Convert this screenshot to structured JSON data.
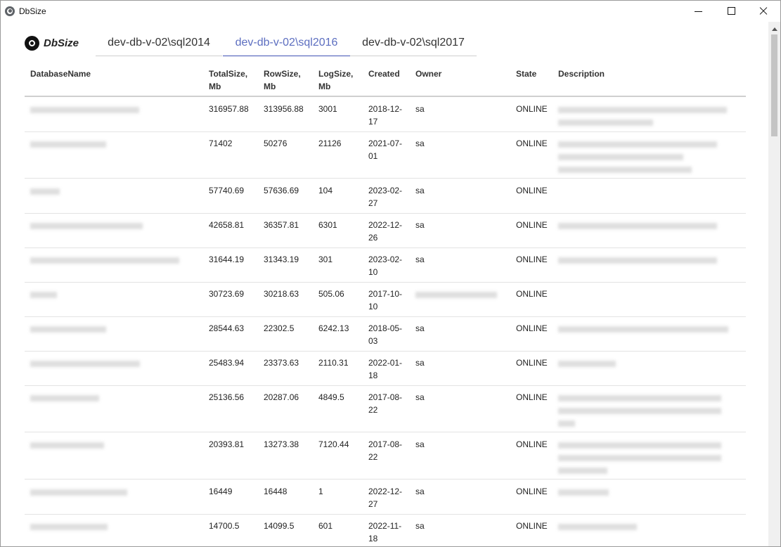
{
  "window": {
    "title": "DbSize",
    "minimize_label": "—",
    "maximize_label": "□",
    "close_label": "✕"
  },
  "brand": {
    "label": "DbSize",
    "icon": "github-icon"
  },
  "tabs": [
    {
      "label": "dev-db-v-02\\sql2014",
      "active": false
    },
    {
      "label": "dev-db-v-02\\sql2016",
      "active": true
    },
    {
      "label": "dev-db-v-02\\sql2017",
      "active": false
    }
  ],
  "table": {
    "headers": [
      "DatabaseName",
      "TotalSize,\nMb",
      "RowSize,\nMb",
      "LogSize,\nMb",
      "Created",
      "Owner",
      "State",
      "Description"
    ],
    "rows": [
      {
        "total": "316957.88",
        "rowsize": "313956.88",
        "logsize": "3001",
        "created": "2018-12-\n17",
        "owner": "sa",
        "state": "ONLINE"
      },
      {
        "total": "71402",
        "rowsize": "50276",
        "logsize": "21126",
        "created": "2021-07-\n01",
        "owner": "sa",
        "state": "ONLINE"
      },
      {
        "total": "57740.69",
        "rowsize": "57636.69",
        "logsize": "104",
        "created": "2023-02-\n27",
        "owner": "sa",
        "state": "ONLINE"
      },
      {
        "total": "42658.81",
        "rowsize": "36357.81",
        "logsize": "6301",
        "created": "2022-12-\n26",
        "owner": "sa",
        "state": "ONLINE"
      },
      {
        "total": "31644.19",
        "rowsize": "31343.19",
        "logsize": "301",
        "created": "2023-02-\n10",
        "owner": "sa",
        "state": "ONLINE"
      },
      {
        "total": "30723.69",
        "rowsize": "30218.63",
        "logsize": "505.06",
        "created": "2017-10-\n10",
        "owner": "",
        "state": "ONLINE"
      },
      {
        "total": "28544.63",
        "rowsize": "22302.5",
        "logsize": "6242.13",
        "created": "2018-05-\n03",
        "owner": "sa",
        "state": "ONLINE"
      },
      {
        "total": "25483.94",
        "rowsize": "23373.63",
        "logsize": "2110.31",
        "created": "2022-01-\n18",
        "owner": "sa",
        "state": "ONLINE"
      },
      {
        "total": "25136.56",
        "rowsize": "20287.06",
        "logsize": "4849.5",
        "created": "2017-08-\n22",
        "owner": "sa",
        "state": "ONLINE"
      },
      {
        "total": "20393.81",
        "rowsize": "13273.38",
        "logsize": "7120.44",
        "created": "2017-08-\n22",
        "owner": "sa",
        "state": "ONLINE"
      },
      {
        "total": "16449",
        "rowsize": "16448",
        "logsize": "1",
        "created": "2022-12-\n27",
        "owner": "sa",
        "state": "ONLINE"
      },
      {
        "total": "14700.5",
        "rowsize": "14099.5",
        "logsize": "601",
        "created": "2022-11-\n18",
        "owner": "sa",
        "state": "ONLINE"
      }
    ]
  }
}
